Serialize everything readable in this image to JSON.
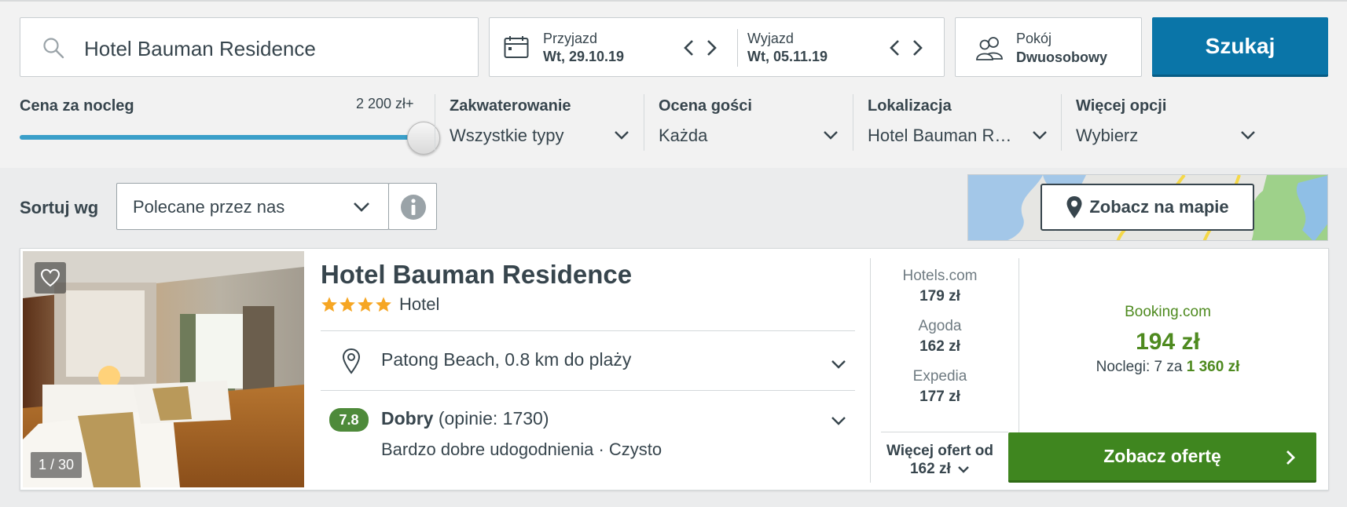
{
  "search": {
    "query": "Hotel Bauman Residence"
  },
  "dates": {
    "checkin_label": "Przyjazd",
    "checkin_value": "Wt, 29.10.19",
    "checkout_label": "Wyjazd",
    "checkout_value": "Wt, 05.11.19"
  },
  "room": {
    "label": "Pokój",
    "value": "Dwuosobowy"
  },
  "search_button": "Szukaj",
  "filters": {
    "price": {
      "title": "Cena za nocleg",
      "max_label": "2 200 zł+",
      "level": 1.0
    },
    "accommodation": {
      "title": "Zakwaterowanie",
      "value": "Wszystkie typy"
    },
    "guest_rating": {
      "title": "Ocena gości",
      "value": "Każda"
    },
    "location": {
      "title": "Lokalizacja",
      "value": "Hotel Bauman R…"
    },
    "more": {
      "title": "Więcej opcji",
      "value": "Wybierz"
    }
  },
  "sort": {
    "label": "Sortuj wg",
    "value": "Polecane przez nas"
  },
  "map_button": "Zobacz na mapie",
  "hotel": {
    "photo_counter": "1 / 30",
    "name": "Hotel Bauman Residence",
    "stars": 4,
    "type": "Hotel",
    "location": "Patong Beach, 0.8 km do plaży",
    "rating_score": "7.8",
    "rating_word": "Dobry",
    "rating_count": "(opinie: 1730)",
    "amenities": "Bardzo dobre udogodnienia · Czysto",
    "offers": [
      {
        "site": "Hotels.com",
        "price": "179 zł"
      },
      {
        "site": "Agoda",
        "price": "162 zł"
      },
      {
        "site": "Expedia",
        "price": "177 zł"
      }
    ],
    "more_offers_label": "Więcej ofert od",
    "more_offers_price": "162 zł",
    "best_site": "Booking.com",
    "best_price": "194 zł",
    "nights_text": "Noclegi: 7 za",
    "nights_total": "1 360 zł",
    "cta": "Zobacz ofertę"
  },
  "colors": {
    "primary": "#0a75a8",
    "cta_green": "#3f861f",
    "price_green": "#4e8a1f",
    "star": "#f6a623"
  }
}
